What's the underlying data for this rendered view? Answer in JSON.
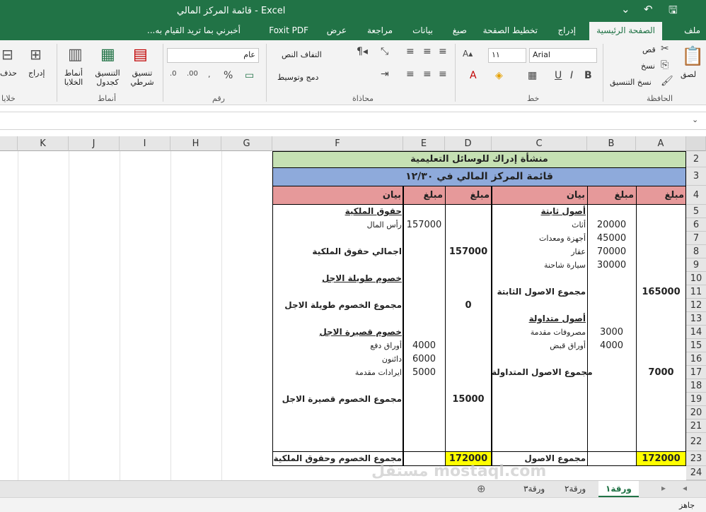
{
  "window": {
    "title": "قائمة المركز المالي - Excel"
  },
  "tabs": [
    "ملف",
    "الصفحة الرئيسية",
    "إدراج",
    "تخطيط الصفحة",
    "صيغ",
    "بيانات",
    "مراجعة",
    "عرض",
    "Foxit PDF"
  ],
  "tell_me": "أخبرني بما تريد القيام به...",
  "ribbon": {
    "clipboard": {
      "group": "الحافظة",
      "paste": "لصق",
      "cut": "قص",
      "copy": "نسخ",
      "format_painter": "نسخ التنسيق"
    },
    "font": {
      "group": "خط",
      "name": "Arial",
      "size": "١١"
    },
    "alignment": {
      "group": "محاذاة",
      "wrap": "التفاف النص",
      "merge": "دمج وتوسيط"
    },
    "number": {
      "group": "رقم",
      "format": "عام"
    },
    "styles": {
      "group": "أنماط",
      "conditional": "تنسيق شرطي",
      "as_table": "التنسيق كجدول",
      "cell_styles": "أنماط الخلايا"
    },
    "cells": {
      "group": "خلايا",
      "insert": "إدراج",
      "delete": "حذف"
    }
  },
  "columns": [
    "A",
    "B",
    "C",
    "D",
    "E",
    "F",
    "G",
    "H",
    "I",
    "J",
    "K"
  ],
  "rows": [
    "2",
    "3",
    "4",
    "5",
    "6",
    "7",
    "8",
    "9",
    "10",
    "11",
    "12",
    "13",
    "14",
    "15",
    "16",
    "17",
    "18",
    "19",
    "20",
    "21",
    "22",
    "23",
    "24"
  ],
  "sheet": {
    "title": "منشأة إدراك للوسائل التعليمية",
    "subtitle": "قائمة المركز المالي في ١٢/٣٠",
    "headers": {
      "amount_a": "مبلغ",
      "amount_b": "مبلغ",
      "desc_c": "بيان",
      "amount_d": "مبلغ",
      "amount_e": "مبلغ",
      "desc_f": "بيان"
    },
    "fixed_assets": "أصول ثابتة",
    "furniture": "أثاث",
    "furniture_v": "20000",
    "equipment": "أجهزة ومعدات",
    "equipment_v": "45000",
    "property": "عقار",
    "property_v": "70000",
    "car": "سيارة شاحنة",
    "car_v": "30000",
    "total_fixed": "مجموع الاصول الثابتة",
    "total_fixed_v": "165000",
    "current_assets": "أصول متداولة",
    "prepaid": "مصروفات مقدمة",
    "prepaid_v": "3000",
    "receivables": "أوراق قبض",
    "receivables_v": "4000",
    "total_current": "مجموع الاصول المتداولة",
    "total_current_v": "7000",
    "total_assets": "مجموع الاصول",
    "total_assets_v": "172000",
    "equity": "حقوق الملكية",
    "capital": "رأس المال",
    "capital_v": "157000",
    "total_equity": "اجمالي حقوق الملكية",
    "total_equity_v": "157000",
    "lt_liab": "خصوم طويلة الاجل",
    "total_lt": "مجموع الخصوم طويلة الاجل",
    "total_lt_v": "0",
    "st_liab": "خصوم قصيرة الاجل",
    "payables": "أوراق دفع",
    "payables_v": "4000",
    "creditors": "دائنون",
    "creditors_v": "6000",
    "unearned": "ايرادات مقدمة",
    "unearned_v": "5000",
    "total_st": "مجموع الخصوم قصيرة الاجل",
    "total_st_v": "15000",
    "total_liab_eq": "مجموع الخصوم وحقوق الملكية",
    "total_liab_eq_v": "172000"
  },
  "sheets": [
    "ورقة١",
    "ورقة٢",
    "ورقة٣"
  ],
  "status": "جاهز",
  "watermark": "مستقل mostaql.com",
  "colors": {
    "excel_green": "#217346",
    "title_fill": "#c5e0b3",
    "subtitle_fill": "#8eaadb",
    "header_fill": "#e6999a",
    "total_fill": "#ffff00"
  }
}
